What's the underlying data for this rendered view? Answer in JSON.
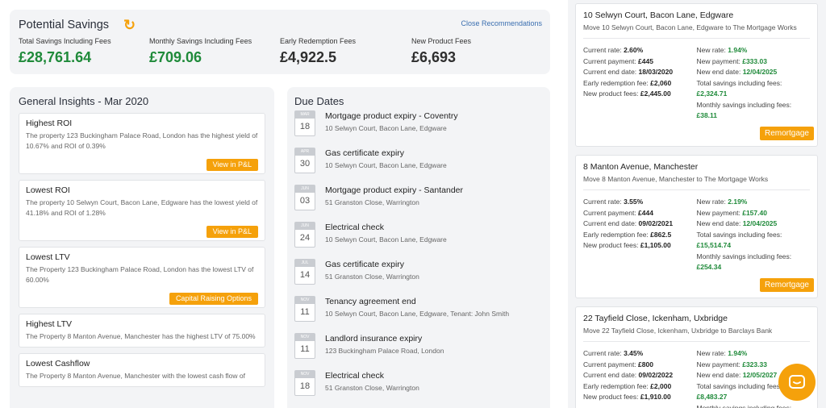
{
  "savings": {
    "title": "Potential Savings",
    "close_label": "Close Recommendations",
    "stats": [
      {
        "label": "Total Savings Including Fees",
        "value": "£28,761.64"
      },
      {
        "label": "Monthly Savings Including Fees",
        "value": "£709.06"
      },
      {
        "label": "Early Redemption Fees",
        "value": "£4,922.5"
      },
      {
        "label": "New Product Fees",
        "value": "£6,693"
      }
    ]
  },
  "insights": {
    "title": "General Insights - Mar 2020",
    "cards": [
      {
        "title": "Highest ROI",
        "text": "The property 123 Buckingham Palace Road, London has the highest yield of 10.67% and ROI of 0.39%",
        "button": "View in P&L"
      },
      {
        "title": "Lowest ROI",
        "text": "The property 10 Selwyn Court, Bacon Lane, Edgware has the lowest yield of 41.18% and ROI of 1.28%",
        "button": "View in P&L"
      },
      {
        "title": "Lowest LTV",
        "text": "The Property 123 Buckingham Palace Road, London has the lowest LTV of 60.00%",
        "button": "Capital Raising Options"
      },
      {
        "title": "Highest LTV",
        "text": "The Property 8 Manton Avenue, Manchester has the highest LTV of 75.00%",
        "button": ""
      },
      {
        "title": "Lowest Cashflow",
        "text": "The Property 8 Manton Avenue, Manchester with the lowest cash flow of",
        "button": ""
      }
    ]
  },
  "due": {
    "title": "Due Dates",
    "items": [
      {
        "month": "MAR",
        "day": "18",
        "title": "Mortgage product expiry - Coventry",
        "address": "10 Selwyn Court, Bacon Lane, Edgware"
      },
      {
        "month": "APR",
        "day": "30",
        "title": "Gas certificate expiry",
        "address": "10 Selwyn Court, Bacon Lane, Edgware"
      },
      {
        "month": "JUN",
        "day": "03",
        "title": "Mortgage product expiry - Santander",
        "address": "51 Granston Close, Warrington"
      },
      {
        "month": "JUN",
        "day": "24",
        "title": "Electrical check",
        "address": "10 Selwyn Court, Bacon Lane, Edgware"
      },
      {
        "month": "JUL",
        "day": "14",
        "title": "Gas certificate expiry",
        "address": "51 Granston Close, Warrington"
      },
      {
        "month": "NOV",
        "day": "11",
        "title": "Tenancy agreement end",
        "address": "10 Selwyn Court, Bacon Lane, Edgware, Tenant: John Smith"
      },
      {
        "month": "NOV",
        "day": "11",
        "title": "Landlord insurance expiry",
        "address": "123 Buckingham Palace Road, London"
      },
      {
        "month": "NOV",
        "day": "18",
        "title": "Electrical check",
        "address": "51 Granston Close, Warrington"
      }
    ]
  },
  "recommendations": [
    {
      "title": "10 Selwyn Court, Bacon Lane, Edgware",
      "move": "Move 10 Selwyn Court, Bacon Lane, Edgware to The Mortgage Works",
      "current_rate": "2.60%",
      "current_payment": "£445",
      "current_end": "18/03/2020",
      "erc": "£2,060",
      "product_fees": "£2,445.00",
      "new_rate": "1.94%",
      "new_payment": "£333.03",
      "new_end": "12/04/2025",
      "total_savings": "£2,324.71",
      "monthly_savings": "£38.11",
      "button": "Remortgage"
    },
    {
      "title": "8 Manton Avenue, Manchester",
      "move": "Move 8 Manton Avenue, Manchester to The Mortgage Works",
      "current_rate": "3.55%",
      "current_payment": "£444",
      "current_end": "09/02/2021",
      "erc": "£862.5",
      "product_fees": "£1,105.00",
      "new_rate": "2.19%",
      "new_payment": "£157.40",
      "new_end": "12/04/2025",
      "total_savings": "£15,514.74",
      "monthly_savings": "£254.34",
      "button": "Remortgage"
    },
    {
      "title": "22 Tayfield Close, Ickenham, Uxbridge",
      "move": "Move 22 Tayfield Close, Ickenham, Uxbridge to Barclays Bank",
      "current_rate": "3.45%",
      "current_payment": "£800",
      "current_end": "09/02/2022",
      "erc": "£2,000",
      "product_fees": "£1,910.00",
      "new_rate": "1.94%",
      "new_payment": "£323.33",
      "new_end": "12/05/2027",
      "total_savings": "£8,483.27",
      "monthly_savings": "",
      "button": ""
    }
  ],
  "labels": {
    "current_rate": "Current rate:",
    "current_payment": "Current payment:",
    "current_end": "Current end date:",
    "erc": "Early redemption fee:",
    "product_fees": "New product fees:",
    "new_rate": "New rate:",
    "new_payment": "New payment:",
    "new_end": "New end date:",
    "total_savings": "Total savings including fees:",
    "monthly_savings": "Monthly savings including fees:"
  }
}
